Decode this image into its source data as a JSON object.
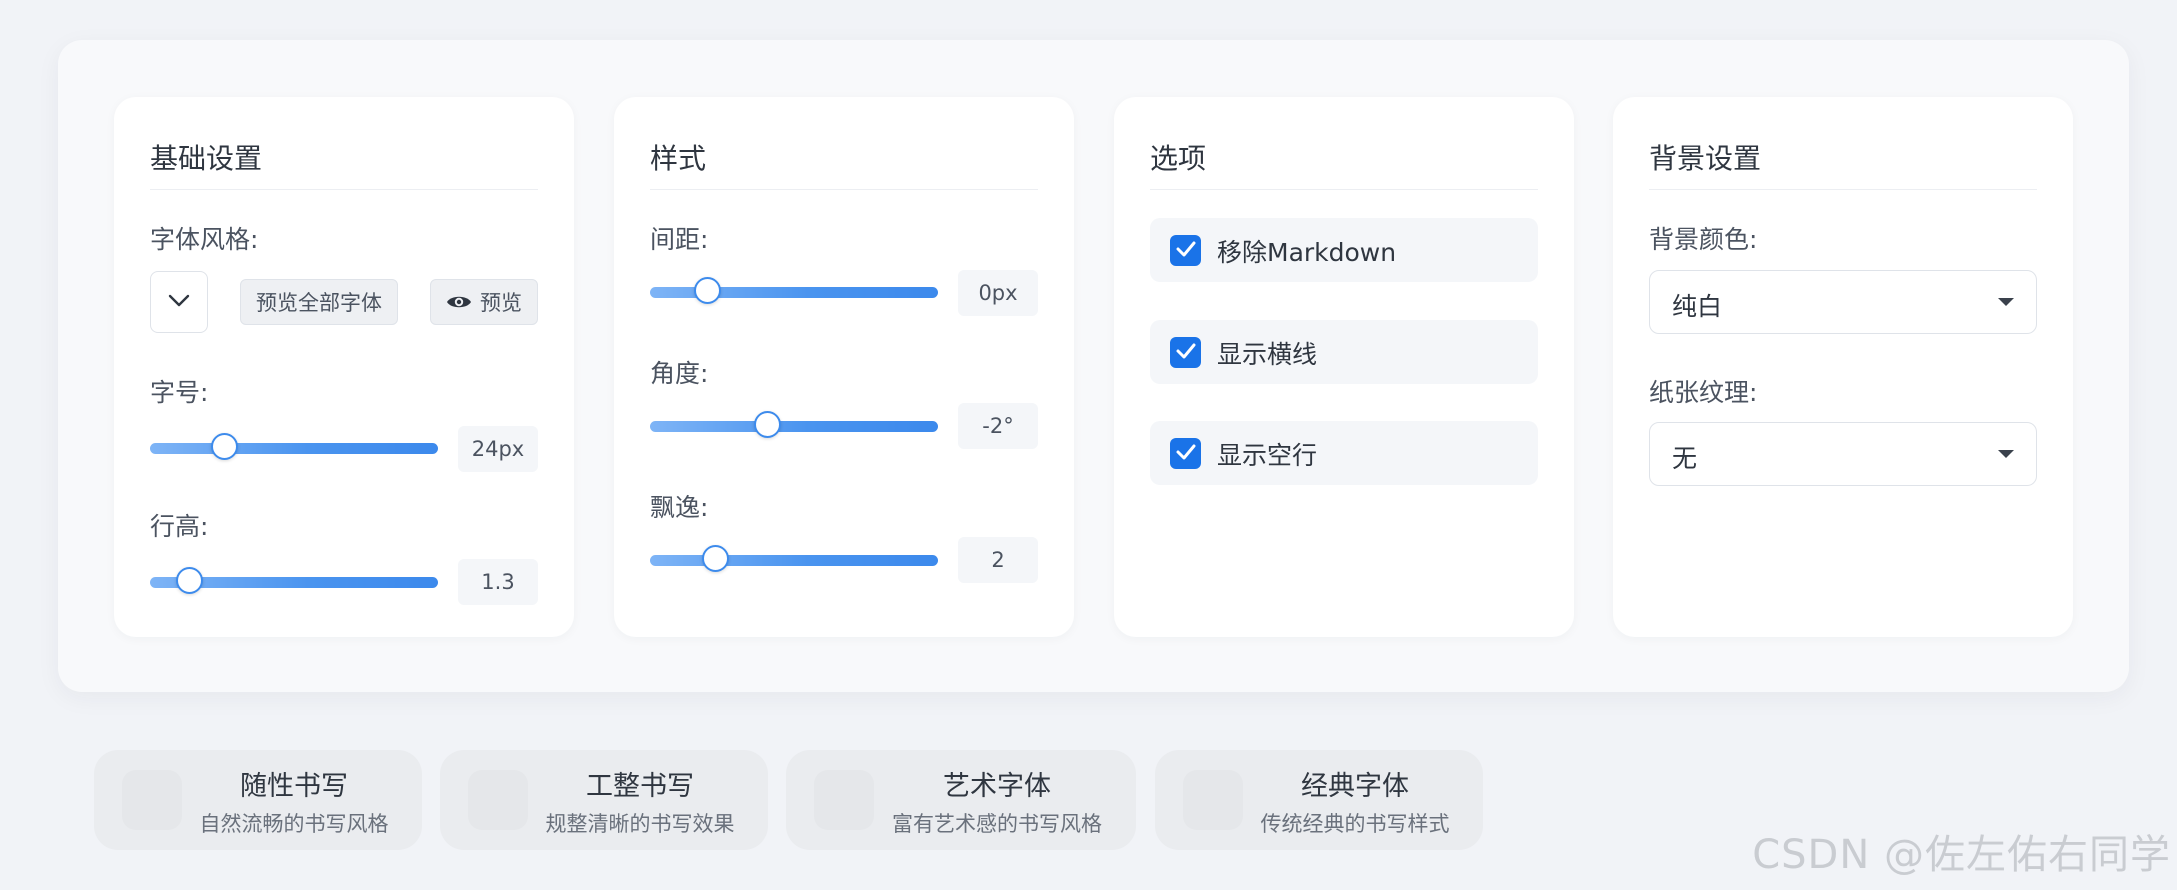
{
  "cards": {
    "basic": {
      "title": "基础设置",
      "font_style_label": "字体风格:",
      "preview_all_label": "预览全部字体",
      "preview_label": "预览",
      "font_size_label": "字号:",
      "font_size_value": "24px",
      "font_size_fraction": 0.26,
      "line_height_label": "行高:",
      "line_height_value": "1.3",
      "line_height_fraction": 0.14
    },
    "style": {
      "title": "样式",
      "spacing_label": "间距:",
      "spacing_value": "0px",
      "spacing_fraction": 0.2,
      "angle_label": "角度:",
      "angle_value": "-2°",
      "angle_fraction": 0.41,
      "float_label": "飘逸:",
      "float_value": "2",
      "float_fraction": 0.23
    },
    "options": {
      "title": "选项",
      "items": [
        {
          "label": "移除Markdown",
          "checked": true
        },
        {
          "label": "显示横线",
          "checked": true
        },
        {
          "label": "显示空行",
          "checked": true
        }
      ]
    },
    "background": {
      "title": "背景设置",
      "bg_color_label": "背景颜色:",
      "bg_color_value": "纯白",
      "texture_label": "纸张纹理:",
      "texture_value": "无"
    }
  },
  "style_tiles": [
    {
      "title": "随性书写",
      "subtitle": "自然流畅的书写风格"
    },
    {
      "title": "工整书写",
      "subtitle": "规整清晰的书写效果"
    },
    {
      "title": "艺术字体",
      "subtitle": "富有艺术感的书写风格"
    },
    {
      "title": "经典字体",
      "subtitle": "传统经典的书写样式"
    }
  ],
  "watermark": "CSDN @佐左佑右同学",
  "colors": {
    "accent": "#1a73e8",
    "slider": "#4a94ef",
    "background": "#f1f3f7"
  }
}
